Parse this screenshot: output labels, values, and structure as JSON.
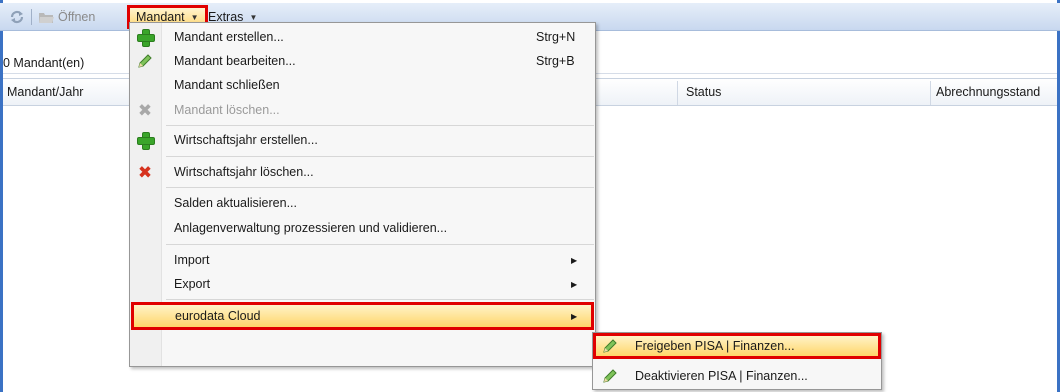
{
  "toolbar": {
    "refresh_icon": "refresh-icon",
    "open_label": "Öffnen",
    "mandant_label": "Mandant",
    "extras_label": "Extras"
  },
  "count_label": "0 Mandant(en)",
  "columns": [
    "Mandant/Jahr",
    "Status",
    "Abrechnungsstand"
  ],
  "menu": {
    "items": [
      {
        "label": "Mandant erstellen...",
        "shortcut": "Strg+N",
        "icon": "green-plus-icon"
      },
      {
        "label": "Mandant bearbeiten...",
        "shortcut": "Strg+B",
        "icon": "pencil-icon"
      },
      {
        "label": "Mandant schließen"
      },
      {
        "label": "Mandant löschen...",
        "icon": "grey-x-icon",
        "disabled": true
      },
      {
        "label": "Wirtschaftsjahr erstellen...",
        "icon": "green-plus-icon"
      },
      {
        "label": "Wirtschaftsjahr löschen...",
        "icon": "red-x-icon"
      },
      {
        "label": "Salden aktualisieren..."
      },
      {
        "label": "Anlagenverwaltung prozessieren und validieren..."
      },
      {
        "label": "Import",
        "submenu": true
      },
      {
        "label": "Export",
        "submenu": true
      },
      {
        "label": "eurodata Cloud",
        "submenu": true,
        "highlighted": true
      }
    ]
  },
  "submenu": {
    "items": [
      {
        "label": "Freigeben PISA | Finanzen...",
        "icon": "pencil-icon",
        "highlighted": true
      },
      {
        "label": "Deaktivieren PISA | Finanzen...",
        "icon": "pencil-icon"
      }
    ]
  },
  "colors": {
    "highlight_border": "#e00000",
    "window_border": "#3b72c4",
    "toolbar_bg": "#c8d8ef"
  }
}
